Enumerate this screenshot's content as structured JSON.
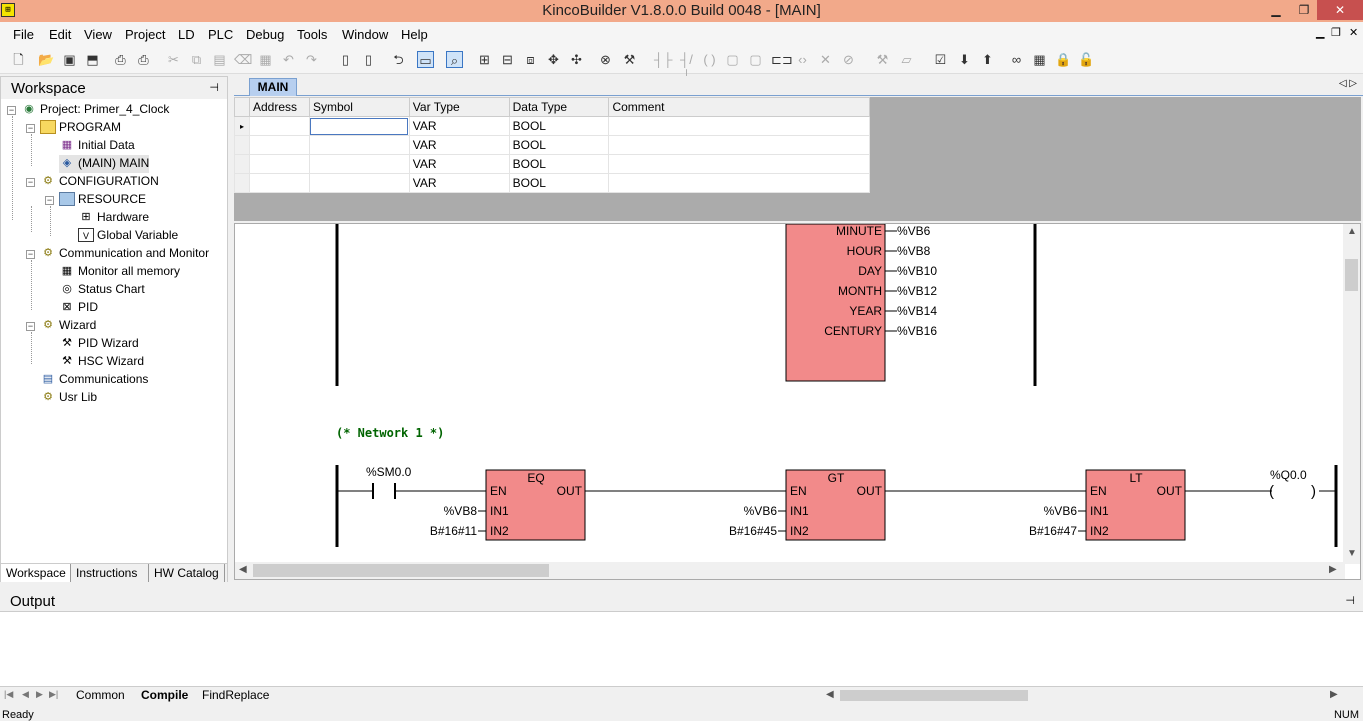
{
  "window": {
    "title": "KincoBuilder V1.8.0.0 Build 0048 - [MAIN]",
    "app_icon": "kinco-app-icon",
    "controls": [
      "minimize",
      "restore",
      "close"
    ]
  },
  "menubar": {
    "items": [
      "File",
      "Edit",
      "View",
      "Project",
      "LD",
      "PLC",
      "Debug",
      "Tools",
      "Window",
      "Help"
    ]
  },
  "toolbar": {
    "icons": [
      "new-icon",
      "open-icon",
      "save-all-icon",
      "open-folder-icon",
      "print-preview-icon",
      "print-icon",
      "cut-icon",
      "copy-icon",
      "paste-icon",
      "delete-icon",
      "undo-icon",
      "redo-icon",
      "page-icon",
      "page-text-icon",
      "back-icon",
      "window-toggle-icon",
      "zoom-icon",
      "insert-network-icon",
      "insert-row-icon",
      "insert-column-icon",
      "move-icon",
      "expand-icon",
      "compile-icon",
      "compile-all-icon",
      "contact-no-icon",
      "contact-nc-icon",
      "coil-icon",
      "box-icon",
      "function-block-icon",
      "branch-icon",
      "remove-icon",
      "delete-branch-icon",
      "tools-icon",
      "monitor-icon",
      "check-icon",
      "download-icon",
      "upload-icon",
      "glasses-icon",
      "table-icon",
      "lock-icon",
      "unlock-icon"
    ]
  },
  "workspace": {
    "title": "Workspace",
    "pin": "⊣",
    "tree": [
      {
        "label": "Project: Primer_4_Clock",
        "icon": "project-icon",
        "level": 0
      },
      {
        "label": "PROGRAM",
        "icon": "folder-icon",
        "level": 1
      },
      {
        "label": "Initial Data",
        "icon": "grid-icon",
        "level": 2
      },
      {
        "label": "(MAIN)  MAIN",
        "icon": "program-icon",
        "level": 2
      },
      {
        "label": "CONFIGURATION",
        "icon": "config-icon",
        "level": 1
      },
      {
        "label": "RESOURCE",
        "icon": "resource-folder-icon",
        "level": 2
      },
      {
        "label": "Hardware",
        "icon": "hardware-icon",
        "level": 3
      },
      {
        "label": "Global Variable",
        "icon": "variable-icon",
        "level": 3
      },
      {
        "label": "Communication and Monitor",
        "icon": "comm-monitor-icon",
        "level": 1
      },
      {
        "label": "Monitor all memory",
        "icon": "memory-grid-icon",
        "level": 2
      },
      {
        "label": "Status Chart",
        "icon": "status-chart-icon",
        "level": 2
      },
      {
        "label": "PID",
        "icon": "pid-icon",
        "level": 2
      },
      {
        "label": "Wizard",
        "icon": "wizard-icon",
        "level": 1
      },
      {
        "label": "PID Wizard",
        "icon": "pid-wizard-icon",
        "level": 2
      },
      {
        "label": "HSC Wizard",
        "icon": "hsc-wizard-icon",
        "level": 2
      },
      {
        "label": "Communications",
        "icon": "communications-icon",
        "level": 1
      },
      {
        "label": "Usr Lib",
        "icon": "user-lib-icon",
        "level": 1
      }
    ],
    "tabs": [
      "Workspace",
      "Instructions",
      "HW Catalog"
    ]
  },
  "document": {
    "tab": "MAIN",
    "var_table": {
      "headers": [
        "Address",
        "Symbol",
        "Var Type",
        "Data Type",
        "Comment"
      ],
      "rows": [
        [
          "",
          "",
          "VAR",
          "BOOL",
          ""
        ],
        [
          "",
          "",
          "VAR",
          "BOOL",
          ""
        ],
        [
          "",
          "",
          "VAR",
          "BOOL",
          ""
        ],
        [
          "",
          "",
          "VAR",
          "BOOL",
          ""
        ]
      ]
    },
    "ld": {
      "top_block": {
        "outputs": [
          {
            "pin": "MINUTE",
            "var": "%VB6"
          },
          {
            "pin": "HOUR",
            "var": "%VB8"
          },
          {
            "pin": "DAY",
            "var": "%VB10"
          },
          {
            "pin": "MONTH",
            "var": "%VB12"
          },
          {
            "pin": "YEAR",
            "var": "%VB14"
          },
          {
            "pin": "CENTURY",
            "var": "%VB16"
          }
        ]
      },
      "network_comment": "(* Network 1 *)",
      "contact": "%SM0.0",
      "blocks": [
        {
          "name": "EQ",
          "en": "EN",
          "out": "OUT",
          "in1": "IN1",
          "in2": "IN2",
          "in1_var": "%VB8",
          "in2_var": "B#16#11"
        },
        {
          "name": "GT",
          "en": "EN",
          "out": "OUT",
          "in1": "IN1",
          "in2": "IN2",
          "in1_var": "%VB6",
          "in2_var": "B#16#45"
        },
        {
          "name": "LT",
          "en": "EN",
          "out": "OUT",
          "in1": "IN1",
          "in2": "IN2",
          "in1_var": "%VB6",
          "in2_var": "B#16#47"
        }
      ],
      "coil": "%Q0.0",
      "colors": {
        "block_fill": "#f28a8a",
        "comment": "#006400",
        "rail": "#000000"
      }
    }
  },
  "output": {
    "title": "Output",
    "tabs": [
      "Common",
      "Compile",
      "FindReplace"
    ],
    "active_tab": "Compile"
  },
  "statusbar": {
    "left": "Ready",
    "right": "NUM"
  }
}
